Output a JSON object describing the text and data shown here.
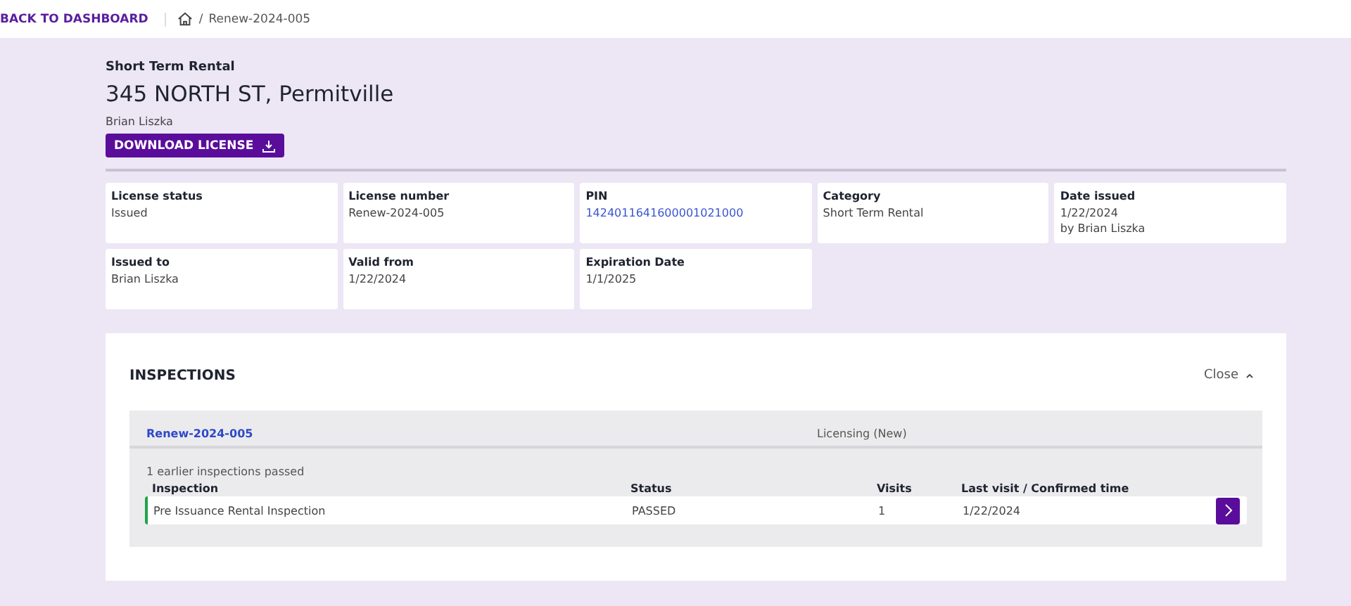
{
  "topbar": {
    "back_link": "BACK TO DASHBOARD",
    "breadcrumb_separator": "/",
    "breadcrumb": [
      {
        "label": "Renew-2024-005"
      }
    ]
  },
  "header": {
    "category": "Short Term Rental",
    "address": "345 NORTH ST, Permitville",
    "owner": "Brian Liszka",
    "download_button": "DOWNLOAD LICENSE"
  },
  "details": [
    {
      "label": "License status",
      "value": "Issued",
      "kind": "text"
    },
    {
      "label": "License number",
      "value": "Renew-2024-005",
      "kind": "text"
    },
    {
      "label": "PIN",
      "value": "1424011641600001021000",
      "kind": "link"
    },
    {
      "label": "Category",
      "value": "Short Term Rental",
      "kind": "text"
    },
    {
      "label": "Date issued",
      "value": "1/22/2024",
      "note": "by Brian Liszka",
      "kind": "text"
    },
    {
      "label": "Issued to",
      "value": "Brian Liszka",
      "kind": "text"
    },
    {
      "label": "Valid from",
      "value": "1/22/2024",
      "kind": "text"
    },
    {
      "label": "Expiration Date",
      "value": "1/1/2025",
      "kind": "text"
    }
  ],
  "inspections": {
    "title": "INSPECTIONS",
    "toggle": "Close",
    "expanded": true,
    "group": {
      "id": "Renew-2024-005",
      "type": "Licensing (New)",
      "summary": "1 earlier inspections passed",
      "columns": [
        "Inspection",
        "Status",
        "Visits",
        "Last visit / Confirmed time"
      ],
      "rows": [
        {
          "inspection": "Pre Issuance Rental Inspection",
          "status": "PASSED",
          "visits": "1",
          "last_visit": "1/22/2024",
          "color": "#1fa34a"
        }
      ]
    }
  }
}
